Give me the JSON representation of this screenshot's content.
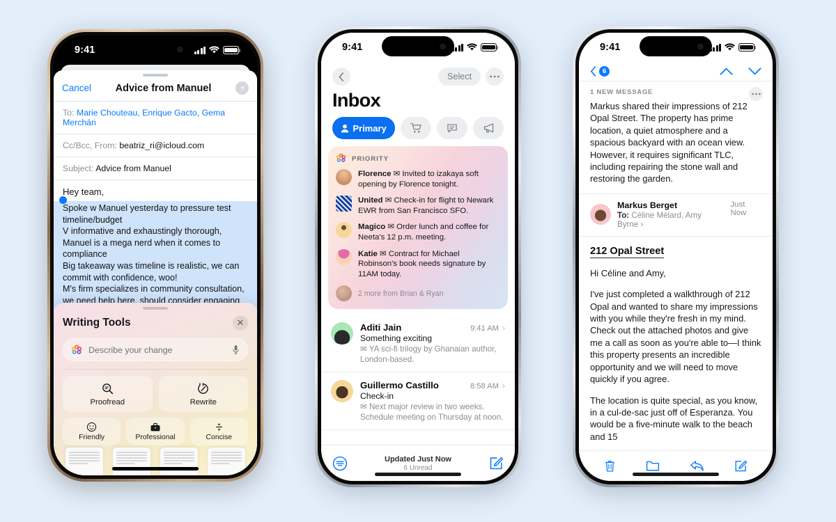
{
  "background_color": "#e3eefb",
  "accent_color": "#0a7bff",
  "phone1": {
    "frame": "gold-titanium",
    "status": {
      "time": "9:41",
      "signal": "cellular-bars",
      "wifi": "wifi-icon",
      "battery": "battery-icon"
    },
    "compose": {
      "cancel_label": "Cancel",
      "title": "Advice from Manuel",
      "send_icon": "arrow-up-icon",
      "to_label": "To:",
      "to_value": "Marie Chouteau, Enrique Gacto, Gema Merchán",
      "cc_label": "Cc/Bcc, From:",
      "cc_value": "beatriz_ri@icloud.com",
      "subject_label": "Subject:",
      "subject_value": "Advice from Manuel",
      "greeting": "Hey team,",
      "selected_text": "Spoke w Manuel yesterday to pressure test timeline/budget\nV informative and exhaustingly thorough, Manuel is a mega nerd when it comes to compliance\nBig takeaway was timeline is realistic, we can commit with confidence, woo!\nM's firm specializes in community consultation, we need help here, should consider engaging",
      "selected_lines": [
        "Spoke w Manuel yesterday to pressure test",
        "timeline/budget",
        "V informative and exhaustingly thorough,",
        "Manuel is a mega nerd when it comes to",
        "compliance",
        "Big takeaway was timeline is realistic, we can",
        "commit with confidence, woo!",
        "M's firm specializes in community consultation,",
        "we need help here, should consider engaging"
      ]
    },
    "writing_tools": {
      "title": "Writing Tools",
      "close_icon": "close-icon",
      "input_placeholder": "Describe your change",
      "sparkle_icon": "apple-intelligence-icon",
      "mic_icon": "microphone-icon",
      "primary_actions": [
        {
          "label": "Proofread",
          "icon": "magnifier-text-icon"
        },
        {
          "label": "Rewrite",
          "icon": "rewrite-dial-icon"
        }
      ],
      "tone_actions": [
        {
          "label": "Friendly",
          "icon": "smiley-icon"
        },
        {
          "label": "Professional",
          "icon": "briefcase-icon"
        },
        {
          "label": "Concise",
          "icon": "concise-icon"
        }
      ]
    }
  },
  "phone2": {
    "frame": "silver-titanium",
    "status": {
      "time": "9:41",
      "signal": "cellular-bars",
      "wifi": "wifi-icon",
      "battery": "battery-icon"
    },
    "nav": {
      "back_icon": "chevron-left-icon",
      "select_label": "Select",
      "more_icon": "ellipsis-icon"
    },
    "title": "Inbox",
    "tabs": [
      {
        "label": "Primary",
        "icon": "person-icon",
        "active": true
      },
      {
        "label": "",
        "icon": "cart-icon",
        "active": false
      },
      {
        "label": "",
        "icon": "speech-bubble-icon",
        "active": false
      },
      {
        "label": "",
        "icon": "megaphone-icon",
        "active": false
      }
    ],
    "priority": {
      "header": "PRIORITY",
      "icon": "apple-intelligence-icon",
      "items": [
        {
          "sender": "Florence",
          "text": "Invited to izakaya soft opening by Florence tonight.",
          "avatar_color": "#b8764d"
        },
        {
          "sender": "United",
          "text": "Check-in for flight to Newark EWR from San Francisco SFO.",
          "avatar_color": "#1a3fa0"
        },
        {
          "sender": "Magico",
          "text": "Order lunch and coffee for Neeta's 12 p.m. meeting.",
          "avatar_color": "#f6d79b"
        },
        {
          "sender": "Katie",
          "text": "Contract for Michael Robinson's book needs signature by 11AM today.",
          "avatar_color": "#f4b8cf"
        }
      ],
      "more_text": "2 more from Brian & Ryan"
    },
    "messages": [
      {
        "name": "Aditi Jain",
        "time": "9:41 AM",
        "subject": "Something exciting",
        "preview": "YA sci-fi trilogy by Ghanaian author, London-based.",
        "avatar_color": "#a9e8b6"
      },
      {
        "name": "Guillermo Castillo",
        "time": "8:58 AM",
        "subject": "Check-in",
        "preview": "Next major review in two weeks. Schedule meeting on Thursday at noon.",
        "avatar_color": "#f6d79b"
      }
    ],
    "bottom": {
      "filter_icon": "filter-icon",
      "status_primary": "Updated Just Now",
      "status_secondary": "6 Unread",
      "compose_icon": "compose-icon"
    }
  },
  "phone3": {
    "frame": "silver-titanium",
    "status": {
      "time": "9:41",
      "signal": "cellular-bars",
      "wifi": "wifi-icon",
      "battery": "battery-icon"
    },
    "nav": {
      "back_icon": "chevron-left-icon",
      "unread_badge": "6",
      "up_icon": "chevron-up-icon",
      "down_icon": "chevron-down-icon"
    },
    "summary": {
      "header": "1 NEW MESSAGE",
      "more_icon": "ellipsis-icon",
      "text": "Markus shared their impressions of 212 Opal Street. The property has prime location, a quiet atmosphere and a spacious backyard with an ocean view. However, it requires significant TLC, including repairing the stone wall and restoring the garden."
    },
    "sender": {
      "name": "Markus Berget",
      "to_label": "To:",
      "to_value": "Céline Mélard, Amy Byrne",
      "chevron": "chevron-right-icon",
      "time": "Just Now",
      "avatar_color": "#f7c6cc"
    },
    "message": {
      "heading": "212 Opal Street",
      "paragraphs": [
        "Hi Céline and Amy,",
        "I've just completed a walkthrough of 212 Opal and wanted to share my impressions with you while they're fresh in my mind. Check out the attached photos and give me a call as soon as you're able to—I think this property presents an incredible opportunity and we will need to move quickly if you agree.",
        "The location is quite special, as you know, in a cul-de-sac just off of Esperanza. You would be a five-minute walk to the beach and 15"
      ]
    },
    "toolbar": [
      {
        "icon": "trash-icon",
        "label": "Delete"
      },
      {
        "icon": "folder-icon",
        "label": "Move"
      },
      {
        "icon": "reply-icon",
        "label": "Reply"
      },
      {
        "icon": "compose-icon",
        "label": "Compose"
      }
    ]
  }
}
